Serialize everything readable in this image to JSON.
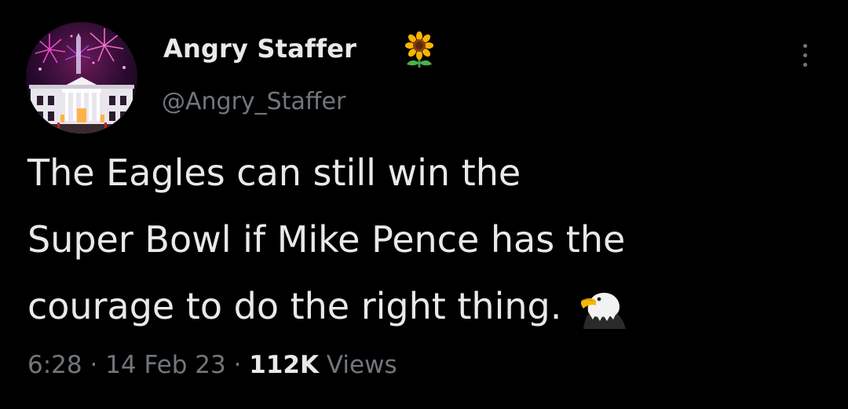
{
  "tweet": {
    "author": {
      "display_name": "Angry Staffer",
      "name_emoji": "sunflower-icon",
      "handle": "@Angry_Staffer",
      "avatar": "white-house-fireworks-avatar"
    },
    "more_icon": "more-options-icon",
    "text_lines": [
      "The Eagles can still win the",
      "Super Bowl if Mike Pence has the",
      "courage to do the right thing."
    ],
    "text_emoji": "eagle-icon",
    "meta": {
      "time": "6:28",
      "separator": "·",
      "date": "14 Feb 23",
      "views_count": "112K",
      "views_label": "Views"
    }
  },
  "colors": {
    "background": "#000000",
    "primary_text": "#e7e9ea",
    "secondary_text": "#71767b"
  }
}
